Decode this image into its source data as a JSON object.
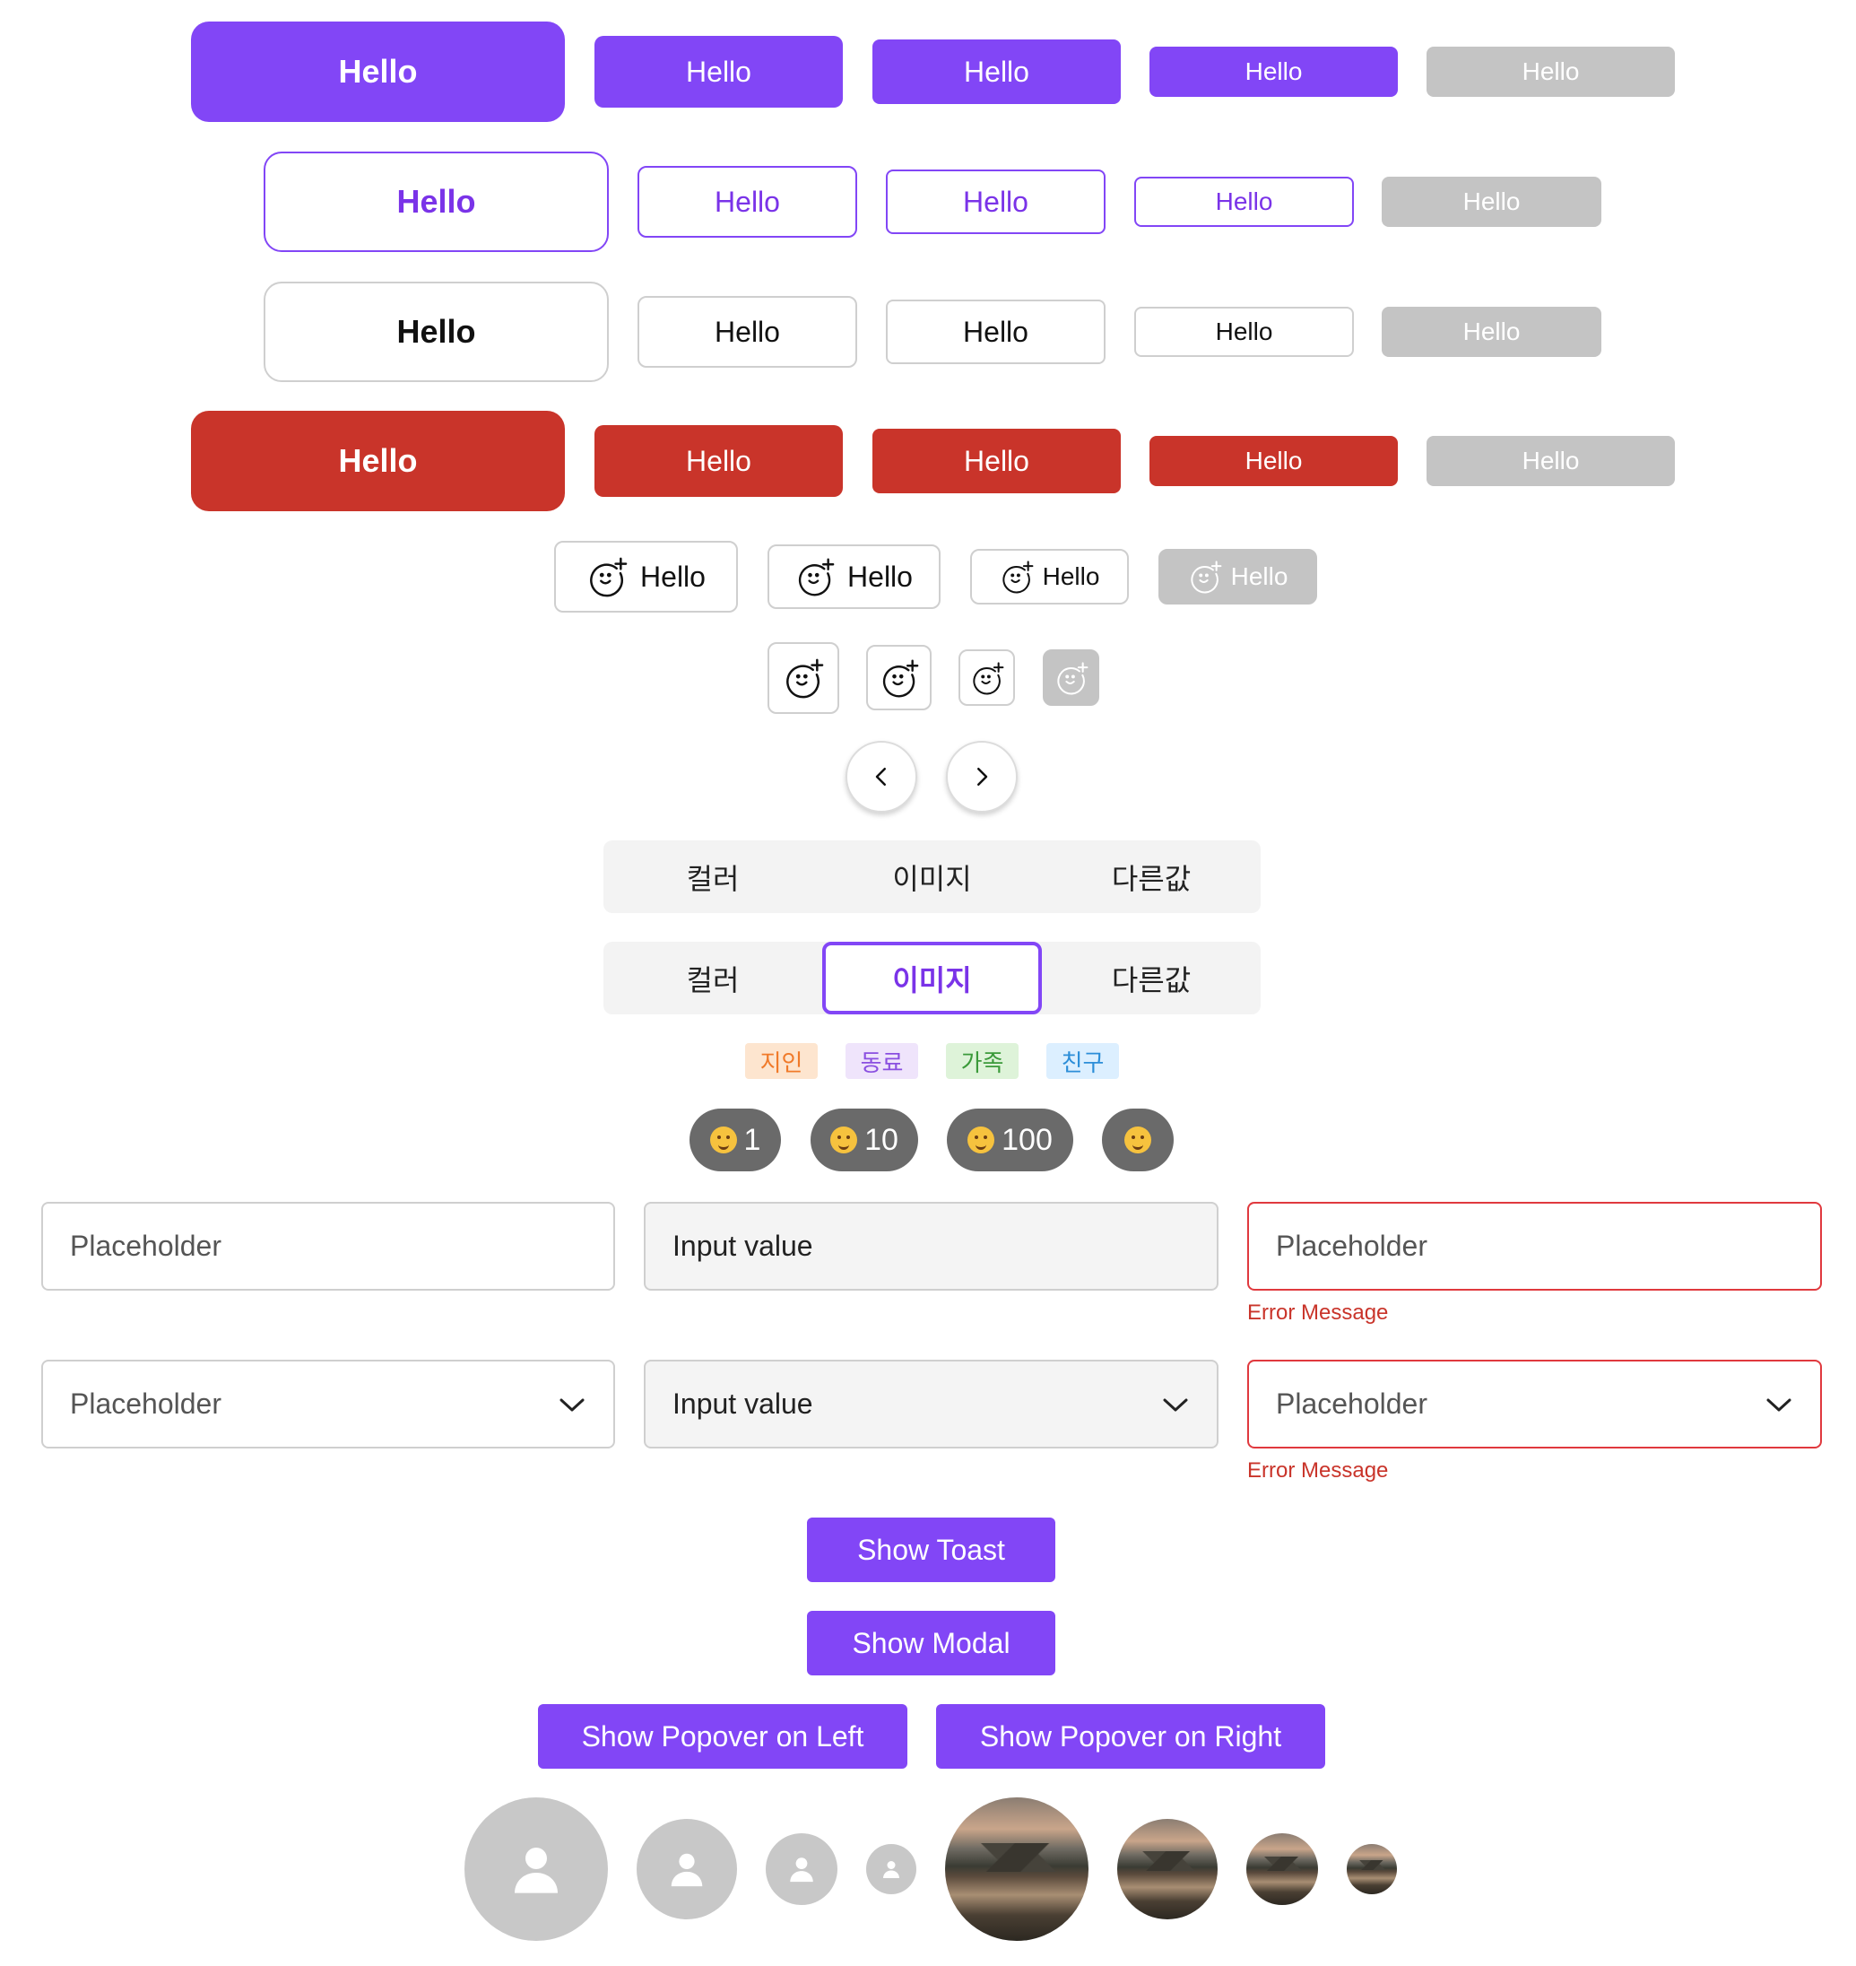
{
  "buttons": {
    "primary": [
      "Hello",
      "Hello",
      "Hello",
      "Hello",
      "Hello"
    ],
    "outline_primary": [
      "Hello",
      "Hello",
      "Hello",
      "Hello",
      "Hello"
    ],
    "outline_gray": [
      "Hello",
      "Hello",
      "Hello",
      "Hello",
      "Hello"
    ],
    "danger": [
      "Hello",
      "Hello",
      "Hello",
      "Hello",
      "Hello"
    ],
    "icon_text": [
      "Hello",
      "Hello",
      "Hello",
      "Hello"
    ],
    "icon_name": "smiley-plus-icon"
  },
  "segmented": {
    "first": {
      "items": [
        "컬러",
        "이미지",
        "다른값"
      ],
      "selected": null
    },
    "second": {
      "items": [
        "컬러",
        "이미지",
        "다른값"
      ],
      "selected": "이미지"
    }
  },
  "tags": [
    {
      "label": "지인",
      "color": "#f07a2a",
      "bg": "#fde5cf"
    },
    {
      "label": "동료",
      "color": "#8a4fe0",
      "bg": "#efe4fb"
    },
    {
      "label": "가족",
      "color": "#3b9a3a",
      "bg": "#def3d9"
    },
    {
      "label": "친구",
      "color": "#2c8ed8",
      "bg": "#dcefff"
    }
  ],
  "reactions": [
    {
      "emoji": "kissing-face-icon",
      "count": "1"
    },
    {
      "emoji": "grinning-face-icon",
      "count": "10"
    },
    {
      "emoji": "winking-face-icon",
      "count": "100"
    },
    {
      "emoji": "smiling-face-icon",
      "count": ""
    }
  ],
  "inputs": {
    "text": [
      {
        "placeholder": "Placeholder",
        "value": "",
        "state": "default"
      },
      {
        "placeholder": "",
        "value": "Input value",
        "state": "filled"
      },
      {
        "placeholder": "Placeholder",
        "value": "",
        "state": "error",
        "error": "Error Message"
      }
    ],
    "select": [
      {
        "placeholder": "Placeholder",
        "value": "",
        "state": "default"
      },
      {
        "placeholder": "",
        "value": "Input value",
        "state": "filled"
      },
      {
        "placeholder": "Placeholder",
        "value": "",
        "state": "error",
        "error": "Error Message"
      }
    ]
  },
  "actions": {
    "toast": "Show Toast",
    "modal": "Show Modal",
    "popover_left": "Show Popover on Left",
    "popover_right": "Show Popover on Right"
  },
  "colors": {
    "primary": "#8246f6",
    "danger": "#c9342a",
    "disabled": "#c4c4c4",
    "error": "#e0393e"
  }
}
